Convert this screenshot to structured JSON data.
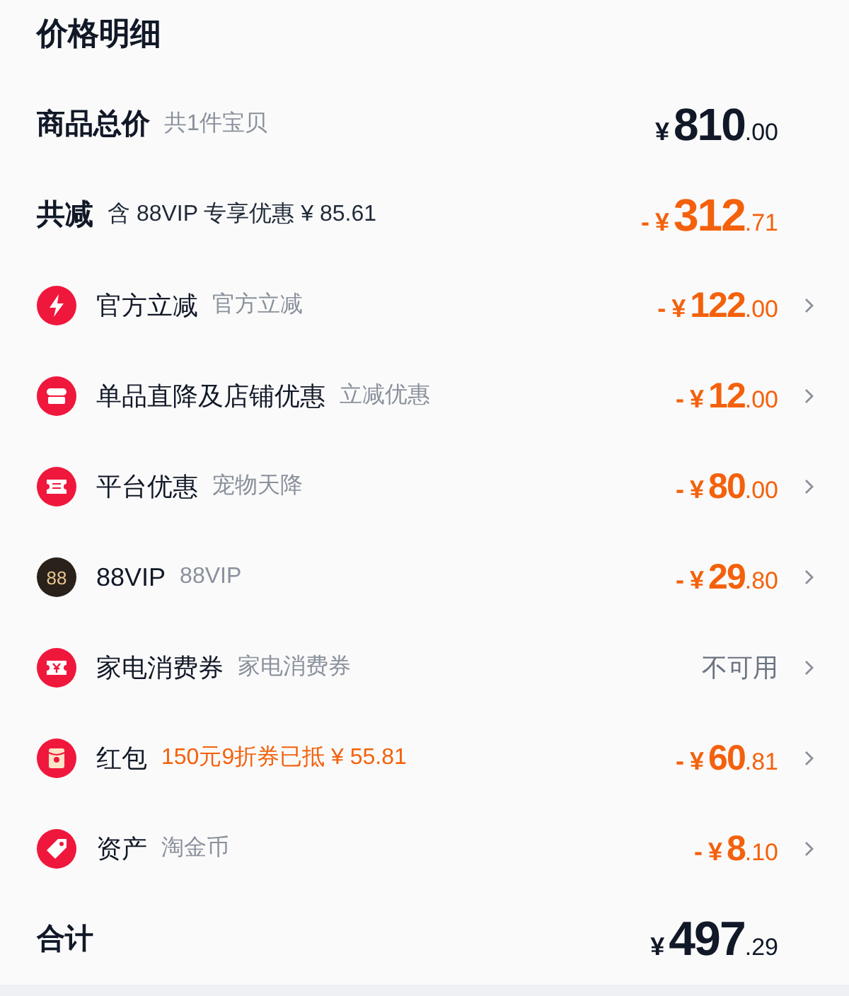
{
  "title": "价格明细",
  "summary": [
    {
      "kind": "total",
      "label": "商品总价",
      "note": "共1件宝贝",
      "amount": {
        "currency": "¥",
        "integer": "810",
        "decimal": ".00"
      }
    },
    {
      "kind": "discount",
      "label": "共减",
      "note": "含 88VIP 专享优惠 ¥ 85.61",
      "amount": {
        "sign": "-",
        "currency": "¥",
        "integer": "312",
        "decimal": ".71"
      }
    }
  ],
  "items": [
    {
      "kind": "bolt",
      "label": "官方立减",
      "note": "官方立减",
      "note_highlighted": false,
      "amount": {
        "sign": "-",
        "currency": "¥",
        "integer": "122",
        "decimal": ".00"
      }
    },
    {
      "kind": "shop",
      "label": "单品直降及店铺优惠",
      "note": "立减优惠",
      "note_highlighted": false,
      "amount": {
        "sign": "-",
        "currency": "¥",
        "integer": "12",
        "decimal": ".00"
      }
    },
    {
      "kind": "ticket",
      "label": "平台优惠",
      "note": "宠物天降",
      "note_highlighted": false,
      "amount": {
        "sign": "-",
        "currency": "¥",
        "integer": "80",
        "decimal": ".00"
      }
    },
    {
      "kind": "badge",
      "badge_text": "88",
      "label": "88VIP",
      "note": "88VIP",
      "note_highlighted": false,
      "amount": {
        "sign": "-",
        "currency": "¥",
        "integer": "29",
        "decimal": ".80"
      }
    },
    {
      "kind": "coupon",
      "label": "家电消费券",
      "note": "家电消费券",
      "note_highlighted": false,
      "status": "不可用"
    },
    {
      "kind": "envelope",
      "label": "红包",
      "note": "150元9折券已抵 ¥ 55.81",
      "note_highlighted": true,
      "amount": {
        "sign": "-",
        "currency": "¥",
        "integer": "60",
        "decimal": ".81"
      }
    },
    {
      "kind": "tag",
      "label": "资产",
      "note": "淘金币",
      "note_highlighted": false,
      "amount": {
        "sign": "-",
        "currency": "¥",
        "integer": "8",
        "decimal": ".10"
      }
    }
  ],
  "total": {
    "label": "合计",
    "amount": {
      "currency": "¥",
      "integer": "497",
      "decimal": ".29"
    }
  }
}
